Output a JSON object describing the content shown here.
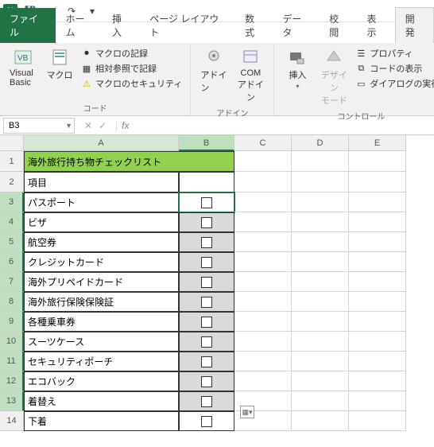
{
  "qat": {
    "save": "💾",
    "undo": "↶",
    "redo": "↷"
  },
  "tabs": {
    "file": "ファイル",
    "home": "ホーム",
    "insert": "挿入",
    "layout": "ページ レイアウト",
    "formula": "数式",
    "data": "データ",
    "review": "校閲",
    "view": "表示",
    "developer": "開発"
  },
  "ribbon": {
    "code_group": "コード",
    "vb": "Visual Basic",
    "macro": "マクロ",
    "rec_macro": "マクロの記録",
    "rel_ref": "相対参照で記録",
    "macro_sec": "マクロのセキュリティ",
    "addin_group": "アドイン",
    "addin": "アドイン",
    "com_addin": "COM\nアドイン",
    "control_group": "コントロール",
    "insert": "挿入",
    "design": "デザイン\nモード",
    "props": "プロパティ",
    "view_code": "コードの表示",
    "run_dialog": "ダイアログの実行"
  },
  "namebox": "B3",
  "fx": "fx",
  "cols": {
    "A": "A",
    "B": "B",
    "C": "C",
    "D": "D",
    "E": "E"
  },
  "data": {
    "title": "海外旅行持ち物チェックリスト",
    "header": "項目",
    "items": [
      "パスポート",
      "ビザ",
      "航空券",
      "クレジットカード",
      "海外プリペイドカード",
      "海外旅行保険保険証",
      "各種乗車券",
      "スーツケース",
      "セキュリティポーチ",
      "エコバック",
      "着替え",
      "下着"
    ]
  },
  "rownums": [
    "1",
    "2",
    "3",
    "4",
    "5",
    "6",
    "7",
    "8",
    "9",
    "10",
    "11",
    "12",
    "13",
    "14"
  ]
}
